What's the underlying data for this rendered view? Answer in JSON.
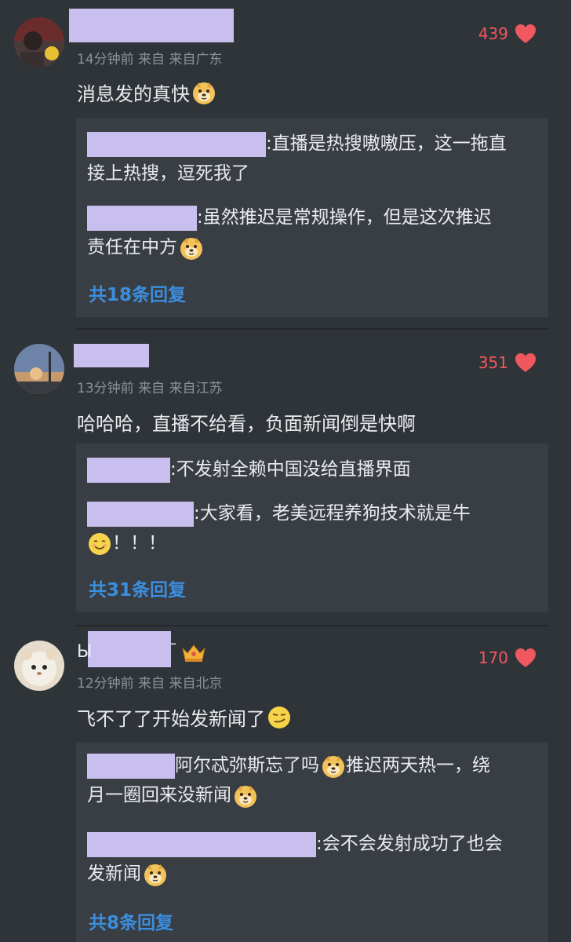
{
  "comments": [
    {
      "likes": "439",
      "meta": "14分钟前 来自 来自广东",
      "text": "消息发的真快",
      "replies": [
        {
          "text": ":直播是热搜嗷嗷压，这一拖直",
          "text2": "接上热搜，逗死我了"
        },
        {
          "text": ":虽然推迟是常规操作，但是这次推迟",
          "text2": "责任在中方"
        }
      ],
      "more": "共18条回复"
    },
    {
      "likes": "351",
      "meta": "13分钟前 来自 来自江苏",
      "text": "哈哈哈，直播不给看，负面新闻倒是快啊",
      "replies": [
        {
          "text": ":不发射全赖中国没给直播界面"
        },
        {
          "text": ":大家看，老美远程养狗技术就是牛",
          "text2": "！！！"
        }
      ],
      "more": "共31条回复"
    },
    {
      "likes": "170",
      "name_prefix": "Ы",
      "name_suffix": "ˉ",
      "meta": "12分钟前 来自 来自北京",
      "text": "飞不了了开始发新闻了",
      "replies": [
        {
          "text": "阿尔忒弥斯忘了吗",
          "text_b": "推迟两天热一，绕",
          "text2": "月一圈回来没新闻"
        },
        {
          "text": ":会不会发射成功了也会",
          "text2": "发新闻"
        }
      ],
      "more": "共8条回复"
    }
  ],
  "colors": {
    "background": "#2f3439",
    "reply_box": "#393e44",
    "like": "#f0585f",
    "link": "#3b8ede",
    "redaction": "#c9bfee"
  },
  "icons": [
    "heart-icon",
    "doge-emoji-icon",
    "smile-emoji-icon",
    "smirk-emoji-icon",
    "crown-badge-icon"
  ]
}
